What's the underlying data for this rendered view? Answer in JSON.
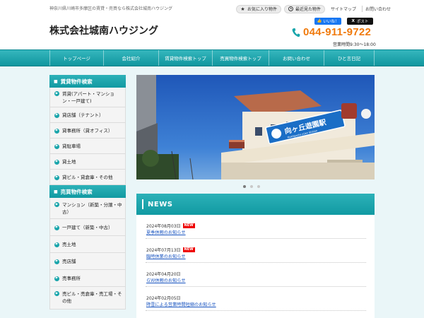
{
  "header": {
    "tagline": "神奈川県川崎市多摩区の賃貸・売買なら株式会社城南ハウジング",
    "site_title": "株式会社城南ハウジング",
    "toplinks": {
      "favorites": "お気に入り物件",
      "recent": "最近見た物件",
      "sitemap": "サイトマップ",
      "contact": "お問い合わせ"
    },
    "sns": {
      "like": "いいね！",
      "post": "ポスト"
    },
    "phone": "044-911-9722",
    "hours": "営業時間9:30～18:00"
  },
  "gnav": [
    "トップページ",
    "会社紹介",
    "賃貸物件検索トップ",
    "売買物件検索トップ",
    "お問い合わせ",
    "ひと言日記"
  ],
  "sidebar": {
    "rental_title": "賃貸物件検索",
    "rental_items": [
      "賃貸(アパート・マンション・一戸建て)",
      "貸店舗（テナント）",
      "貸事務所（貸オフィス）",
      "貸駐車場",
      "貸土地",
      "貸ビル・貸倉庫・その他"
    ],
    "sale_title": "売買物件検索",
    "sale_items": [
      "マンション（新築・分譲・中古）",
      "一戸建て（新築・中古）",
      "売土地",
      "売店舗",
      "売事務所",
      "売ビル・売倉庫・売工場・その他"
    ]
  },
  "slider": {
    "sign_text": "向ヶ丘遊園駅",
    "sign_sub": "Mukōgaoka-yūen Station",
    "dots": 3,
    "active_dot": 1
  },
  "news": {
    "title": "NEWS",
    "badge": "NEW",
    "items": [
      {
        "date": "2024年08月03日",
        "title": "夏季休暇のお知らせ"
      },
      {
        "date": "2024年07月13日",
        "title": "臨時休業のお知らせ"
      },
      {
        "date": "2024年04月20日",
        "title": "ＧＷ休暇のお知らせ"
      },
      {
        "date": "2024年02月05日",
        "title": "降雪による営業時間短縮のお知らせ"
      }
    ]
  },
  "colors": {
    "accent": "#1aa5ab",
    "phone": "#f07a0c",
    "content_bg": "#eaf6f8",
    "new_badge": "#ee0000",
    "link": "#1a55c0"
  }
}
